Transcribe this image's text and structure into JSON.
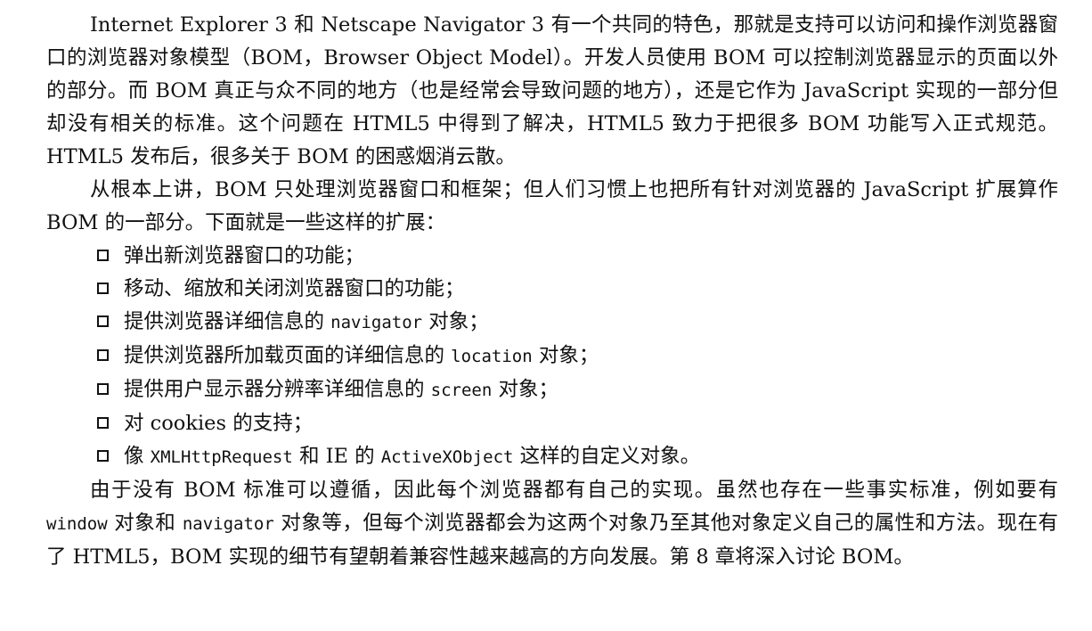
{
  "document": {
    "para1": "Internet Explorer 3 和 Netscape Navigator 3 有一个共同的特色，那就是支持可以访问和操作浏览器窗口的浏览器对象模型（BOM，Browser Object Model）。开发人员使用 BOM 可以控制浏览器显示的页面以外的部分。而 BOM 真正与众不同的地方（也是经常会导致问题的地方），还是它作为 JavaScript 实现的一部分但却没有相关的标准。这个问题在 HTML5 中得到了解决，HTML5 致力于把很多 BOM 功能写入正式规范。HTML5 发布后，很多关于 BOM 的困惑烟消云散。",
    "para2": "从根本上讲，BOM 只处理浏览器窗口和框架；但人们习惯上也把所有针对浏览器的 JavaScript 扩展算作 BOM 的一部分。下面就是一些这样的扩展：",
    "list": [
      {
        "parts": [
          {
            "t": "弹出新浏览器窗口的功能；",
            "code": false
          }
        ]
      },
      {
        "parts": [
          {
            "t": "移动、缩放和关闭浏览器窗口的功能；",
            "code": false
          }
        ]
      },
      {
        "parts": [
          {
            "t": "提供浏览器详细信息的 ",
            "code": false
          },
          {
            "t": "navigator",
            "code": true
          },
          {
            "t": " 对象；",
            "code": false
          }
        ]
      },
      {
        "parts": [
          {
            "t": "提供浏览器所加载页面的详细信息的 ",
            "code": false
          },
          {
            "t": "location",
            "code": true
          },
          {
            "t": " 对象；",
            "code": false
          }
        ]
      },
      {
        "parts": [
          {
            "t": "提供用户显示器分辨率详细信息的 ",
            "code": false
          },
          {
            "t": "screen",
            "code": true
          },
          {
            "t": " 对象；",
            "code": false
          }
        ]
      },
      {
        "parts": [
          {
            "t": "对 cookies 的支持；",
            "code": false
          }
        ]
      },
      {
        "parts": [
          {
            "t": "像 ",
            "code": false
          },
          {
            "t": "XMLHttpRequest",
            "code": true
          },
          {
            "t": " 和 IE 的 ",
            "code": false
          },
          {
            "t": "ActiveXObject",
            "code": true
          },
          {
            "t": " 这样的自定义对象。",
            "code": false
          }
        ]
      }
    ],
    "para3": [
      {
        "t": "由于没有 BOM 标准可以遵循，因此每个浏览器都有自己的实现。虽然也存在一些事实标准，例如要有 ",
        "code": false
      },
      {
        "t": "window",
        "code": true
      },
      {
        "t": " 对象和 ",
        "code": false
      },
      {
        "t": "navigator",
        "code": true
      },
      {
        "t": " 对象等，但每个浏览器都会为这两个对象乃至其他对象定义自己的属性和方法。现在有了 HTML5，BOM 实现的细节有望朝着兼容性越来越高的方向发展。第 8 章将深入讨论 BOM。",
        "code": false
      }
    ]
  }
}
